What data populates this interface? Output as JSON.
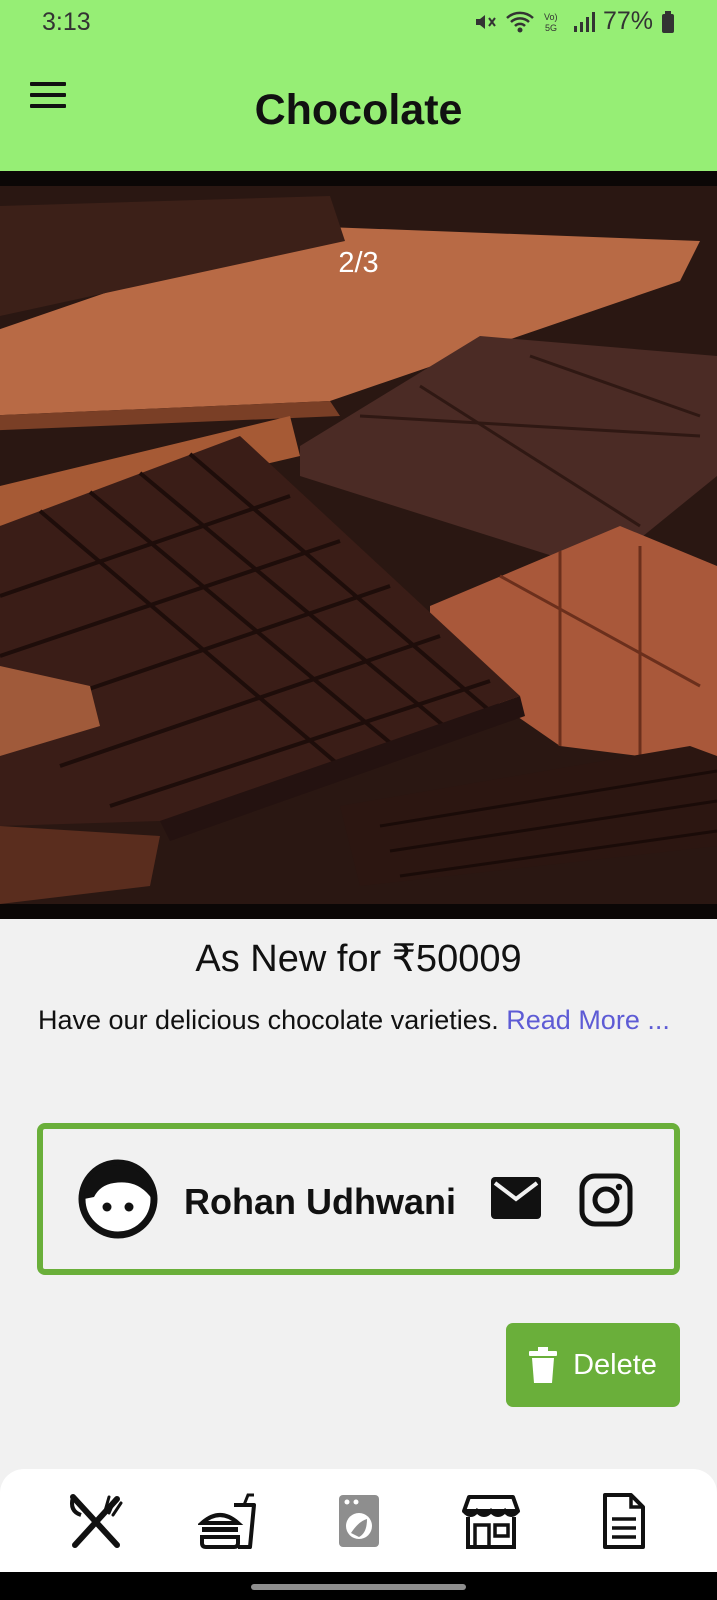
{
  "status_bar": {
    "time": "3:13",
    "battery": "77%",
    "icons": [
      "mute-icon",
      "wifi-icon",
      "volte-5g-icon",
      "signal-icon",
      "battery-icon"
    ]
  },
  "app_bar": {
    "title": "Chocolate",
    "menu_icon": "hamburger-menu-icon"
  },
  "carousel": {
    "counter": "2/3",
    "current_index": 2,
    "total": 3
  },
  "listing": {
    "price_title": "As New for ₹50009",
    "description": "Have our delicious chocolate varieties.",
    "read_more": "Read More ..."
  },
  "seller": {
    "name": "Rohan Udhwani",
    "avatar_icon": "face-icon",
    "contact_icons": [
      "mail-icon",
      "instagram-icon"
    ]
  },
  "actions": {
    "delete_label": "Delete",
    "delete_icon": "trash-icon"
  },
  "bottom_nav": {
    "items": [
      "restaurant-icon",
      "fast-food-icon",
      "laundry-icon",
      "store-icon",
      "document-icon"
    ]
  },
  "colors": {
    "app_bar": "#96ee75",
    "accent": "#6aaf3a",
    "link": "#5d5bd5",
    "background": "#f1f1f1"
  }
}
